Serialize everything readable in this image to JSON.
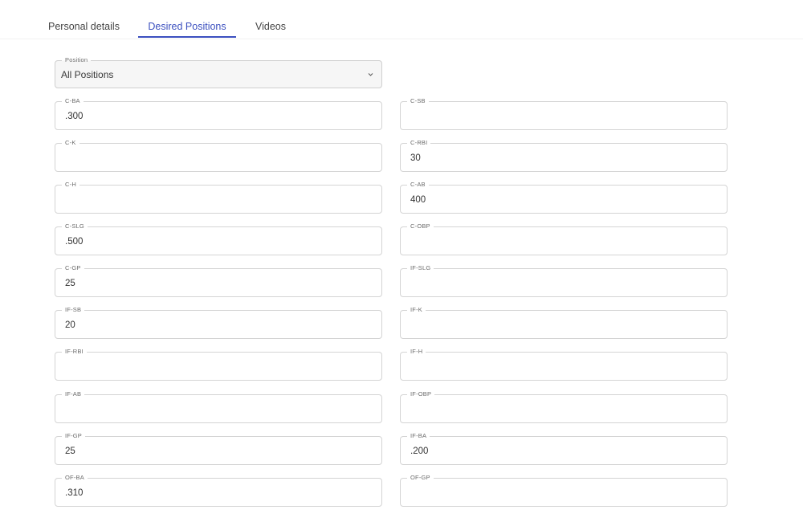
{
  "tabs": [
    {
      "label": "Personal details"
    },
    {
      "label": "Desired Positions"
    },
    {
      "label": "Videos"
    }
  ],
  "position": {
    "label": "Position",
    "value": "All Positions"
  },
  "fields": {
    "c_ba": {
      "label": "C-BA",
      "value": ".300"
    },
    "c_sb": {
      "label": "C-SB",
      "value": ""
    },
    "c_k": {
      "label": "C-K",
      "value": ""
    },
    "c_rbi": {
      "label": "C-RBI",
      "value": "30"
    },
    "c_h": {
      "label": "C-H",
      "value": ""
    },
    "c_ab": {
      "label": "C-AB",
      "value": "400"
    },
    "c_slg": {
      "label": "C-SLG",
      "value": ".500"
    },
    "c_obp": {
      "label": "C-OBP",
      "value": ""
    },
    "c_gp": {
      "label": "C-GP",
      "value": "25"
    },
    "if_slg": {
      "label": "IF-SLG",
      "value": ""
    },
    "if_sb": {
      "label": "IF-SB",
      "value": "20"
    },
    "if_k": {
      "label": "IF-K",
      "value": ""
    },
    "if_rbi": {
      "label": "IF-RBI",
      "value": ""
    },
    "if_h": {
      "label": "IF-H",
      "value": ""
    },
    "if_ab": {
      "label": "IF-AB",
      "value": ""
    },
    "if_obp": {
      "label": "IF-OBP",
      "value": ""
    },
    "if_gp": {
      "label": "IF-GP",
      "value": "25"
    },
    "if_ba": {
      "label": "IF-BA",
      "value": ".200"
    },
    "of_ba": {
      "label": "OF-BA",
      "value": ".310"
    },
    "of_gp": {
      "label": "OF-GP",
      "value": ""
    }
  },
  "colors": {
    "accent": "#3b4fbf",
    "border": "#d4d4d4"
  }
}
